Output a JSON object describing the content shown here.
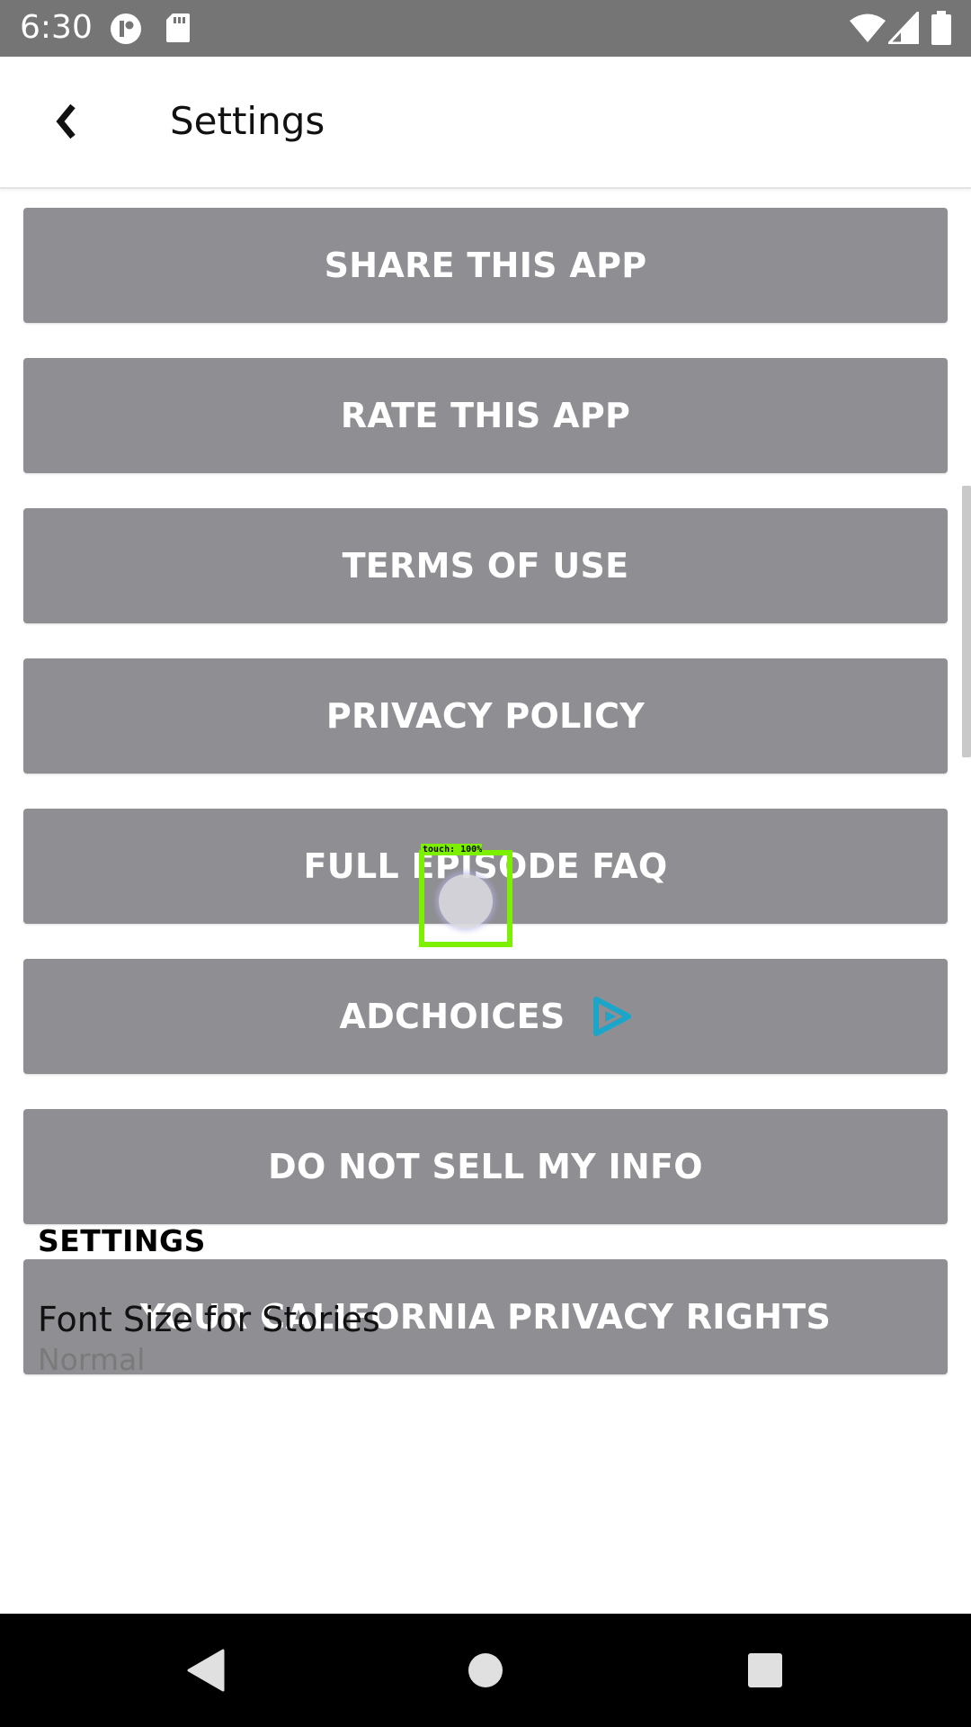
{
  "status_bar": {
    "time": "6:30",
    "icons": [
      "notification-app-icon",
      "sd-card-icon",
      "wifi-icon",
      "cellular-signal-icon",
      "battery-icon"
    ]
  },
  "app_bar": {
    "back_icon": "chevron-left-icon",
    "title": "Settings"
  },
  "buttons": [
    {
      "label": "SHARE THIS APP"
    },
    {
      "label": "RATE THIS APP"
    },
    {
      "label": "TERMS OF USE"
    },
    {
      "label": "PRIVACY POLICY"
    },
    {
      "label": "FULL EPISODE FAQ"
    },
    {
      "label": "ADCHOICES",
      "icon": "adchoices-icon"
    },
    {
      "label": "DO NOT SELL MY INFO"
    },
    {
      "label": "YOUR CALIFORNIA PRIVACY RIGHTS"
    }
  ],
  "settings_section": {
    "header": "SETTINGS",
    "items": [
      {
        "title": "Font Size for Stories",
        "value": "Normal"
      }
    ]
  },
  "touch_indicator": {
    "label": "touch: 100%"
  },
  "nav_bar": {
    "icons": [
      "back-triangle-icon",
      "home-circle-icon",
      "recents-square-icon"
    ]
  },
  "colors": {
    "status_bar": "#757575",
    "button_bg": "#8f8e93",
    "button_text": "#ffffff",
    "adchoices_accent": "#1aa5c9",
    "touch_box": "#7cf000",
    "nav_bar": "#000000"
  }
}
